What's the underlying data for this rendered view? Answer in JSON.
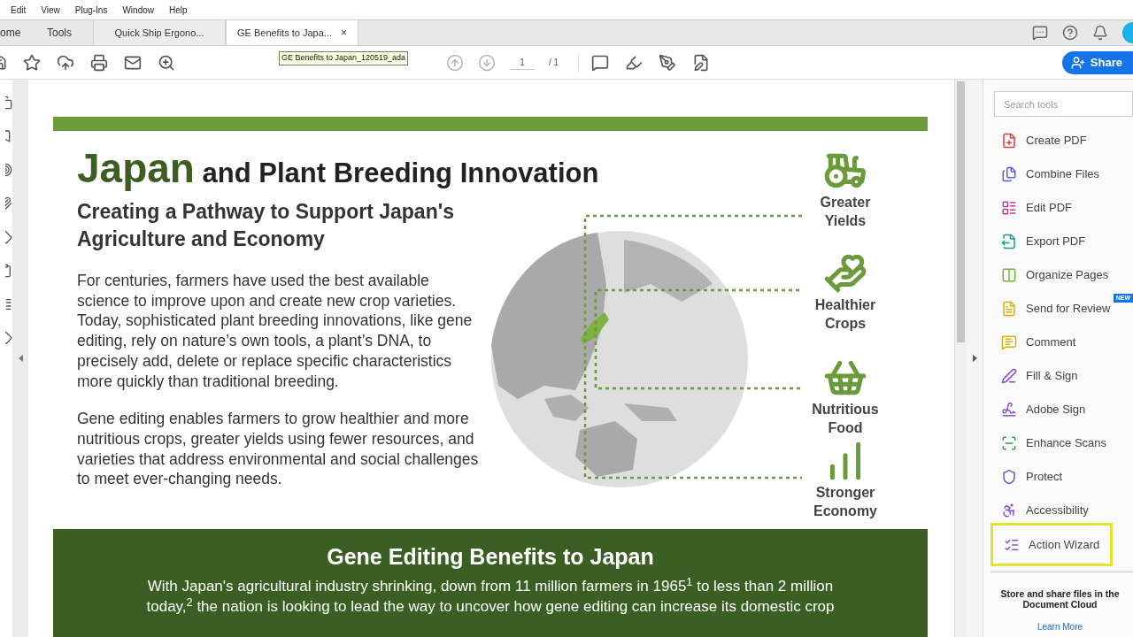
{
  "menu": [
    "Edit",
    "View",
    "Plug-Ins",
    "Window",
    "Help"
  ],
  "nav_tabs": [
    {
      "label": "ome",
      "selected": false
    },
    {
      "label": "Tools",
      "selected": false
    }
  ],
  "doc_tabs": [
    {
      "label": "Quick Ship Ergono...",
      "selected": false
    },
    {
      "label": "GE Benefits to Japa...",
      "selected": true,
      "close": "×"
    }
  ],
  "tooltip": "GE Benefits to Japan_120519_ada",
  "page": {
    "current": "1",
    "total": "/ 1"
  },
  "share": "Share",
  "tools_pane": {
    "search": {
      "placeholder": "Search tools"
    },
    "tools": [
      {
        "label": "Create PDF",
        "selected": false
      },
      {
        "label": "Combine Files",
        "selected": false
      },
      {
        "label": "Edit PDF",
        "selected": false
      },
      {
        "label": "Export PDF",
        "selected": false
      },
      {
        "label": "Organize Pages",
        "selected": false
      },
      {
        "label": "Send for Review",
        "selected": false,
        "badge": "NEW"
      },
      {
        "label": "Comment",
        "selected": false
      },
      {
        "label": "Fill & Sign",
        "selected": false
      },
      {
        "label": "Adobe Sign",
        "selected": false
      },
      {
        "label": "Enhance Scans",
        "selected": false
      },
      {
        "label": "Protect",
        "selected": false
      },
      {
        "label": "Accessibility",
        "selected": false
      },
      {
        "label": "Action Wizard",
        "selected": true
      }
    ],
    "promo": "Store and share files in the Document Cloud",
    "promo_link": "Learn More"
  },
  "document": {
    "title_highlight": "Japan",
    "title_rest": "and Plant Breeding Innovation",
    "subtitle": "Creating a Pathway to Support Japan's Agriculture and Economy",
    "paragraphs": [
      "For centuries, farmers have used the best available science to improve upon and create new crop varieties. Today, sophisticated plant breeding innovations, like gene editing, rely on nature’s own tools, a plant’s DNA, to precisely add, delete or replace specific characteristics more quickly than traditional breeding.",
      "Gene editing enables farmers to grow healthier and more nutritious crops, greater yields using fewer resources, and varieties that address environmental and social challenges to meet ever-changing needs."
    ],
    "benefits": [
      {
        "lines": [
          "Greater",
          "Yields"
        ]
      },
      {
        "lines": [
          "Healthier",
          "Crops"
        ]
      },
      {
        "lines": [
          "Nutritious",
          "Food"
        ]
      },
      {
        "lines": [
          "Stronger",
          "Economy"
        ]
      }
    ],
    "banner": {
      "heading": "Gene Editing Benefits to Japan",
      "lines": [
        "With Japan's agricultural industry shrinking, down from 11 million farmers in 1965$^{1}$ to less than 2 million",
        "today,$^{2}$ the nation is looking to lead the way to uncover how gene editing can increase its domestic crop"
      ]
    }
  }
}
